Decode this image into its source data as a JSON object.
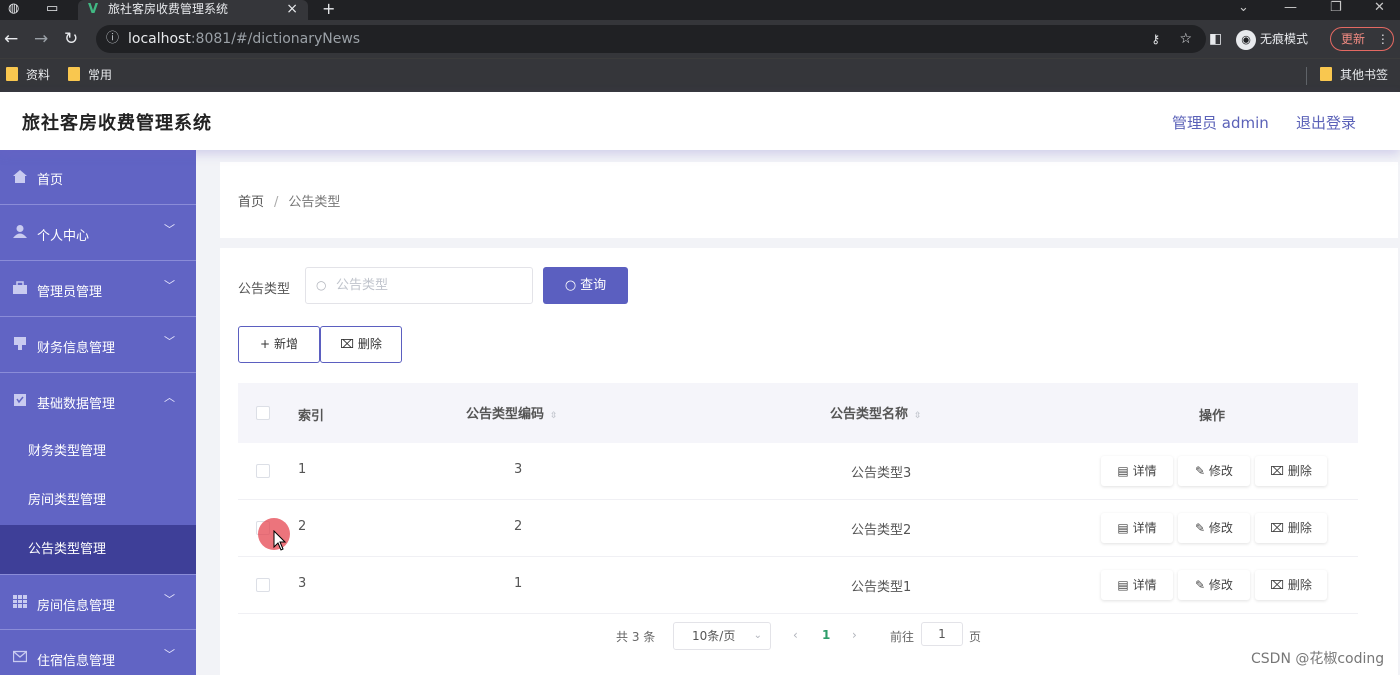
{
  "browser": {
    "tab_title": "旅社客房收费管理系统",
    "url_host": "localhost",
    "url_rest": ":8081/#/dictionaryNews",
    "incognito_label": "无痕模式",
    "update_label": "更新",
    "bookmarks": [
      "资料",
      "常用"
    ],
    "other_bookmarks": "其他书签"
  },
  "header": {
    "title": "旅社客房收费管理系统",
    "user": "管理员 admin",
    "logout": "退出登录"
  },
  "sidebar": {
    "items": [
      {
        "label": "首页"
      },
      {
        "label": "个人中心"
      },
      {
        "label": "管理员管理"
      },
      {
        "label": "财务信息管理"
      },
      {
        "label": "基础数据管理"
      },
      {
        "label": "房间信息管理"
      },
      {
        "label": "住宿信息管理"
      }
    ],
    "subitems": [
      {
        "label": "财务类型管理"
      },
      {
        "label": "房间类型管理"
      },
      {
        "label": "公告类型管理"
      }
    ]
  },
  "breadcrumb": {
    "home": "首页",
    "current": "公告类型"
  },
  "search": {
    "label": "公告类型",
    "placeholder": "公告类型",
    "query_button": "查询"
  },
  "actions": {
    "add": "新增",
    "delete": "删除"
  },
  "table": {
    "columns": [
      "索引",
      "公告类型编码",
      "公告类型名称",
      "操作"
    ],
    "rows": [
      {
        "index": "1",
        "code": "3",
        "name": "公告类型3"
      },
      {
        "index": "2",
        "code": "2",
        "name": "公告类型2"
      },
      {
        "index": "3",
        "code": "1",
        "name": "公告类型1"
      }
    ],
    "op_labels": {
      "detail": "详情",
      "edit": "修改",
      "delete": "删除"
    }
  },
  "pagination": {
    "total": "共 3 条",
    "page_size": "10条/页",
    "current_page": "1",
    "goto_prefix": "前往",
    "goto_value": "1",
    "goto_suffix": "页"
  },
  "watermark": "CSDN @花椒coding",
  "colors": {
    "sidebar": "#6164c4",
    "sidebar_active": "#3e3f98",
    "primary": "#5b5fc0"
  }
}
